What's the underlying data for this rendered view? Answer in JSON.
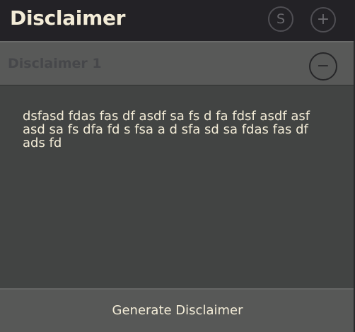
{
  "header": {
    "title": "Disclaimer",
    "s_button_label": "S",
    "add_button_label": "+"
  },
  "section": {
    "label": "Disclaimer 1",
    "remove_button_label": "−"
  },
  "content": {
    "text": "dsfasd fdas fas df asdf sa fs d fa fdsf asdf asf asd sa fs dfa fd s fsa a d sfa sd sa fdas fas df ads fd"
  },
  "footer": {
    "generate_label": "Generate Disclaimer"
  },
  "colors": {
    "background": "#232226",
    "title_text": "#f3ecd7",
    "section_bar": "#585958",
    "content_bg": "#424443",
    "footer_bg": "#575857"
  },
  "icons": {
    "s_button": "s-circle-icon",
    "add_button": "plus-circle-icon",
    "remove_button": "minus-circle-icon"
  }
}
